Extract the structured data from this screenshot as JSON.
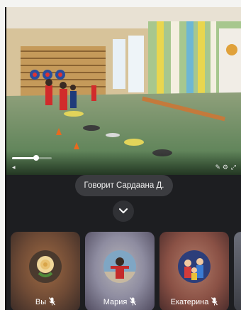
{
  "call": {
    "speaker_text": "Говорит Сардаана Д.",
    "video_progress_pct": 60
  },
  "participants": [
    {
      "name": "Вы",
      "muted": true,
      "avatar_icon": "rose-avatar"
    },
    {
      "name": "Мария",
      "muted": true,
      "avatar_icon": "person-avatar"
    },
    {
      "name": "Екатерина",
      "muted": true,
      "avatar_icon": "group-photo-avatar"
    }
  ],
  "icons": {
    "collapse": "chevron-down-icon",
    "mic": "mic-off-icon"
  },
  "colors": {
    "panel_bg": "#1d1e21",
    "pill_bg": "#3b3c40",
    "text": "#ffffff"
  }
}
